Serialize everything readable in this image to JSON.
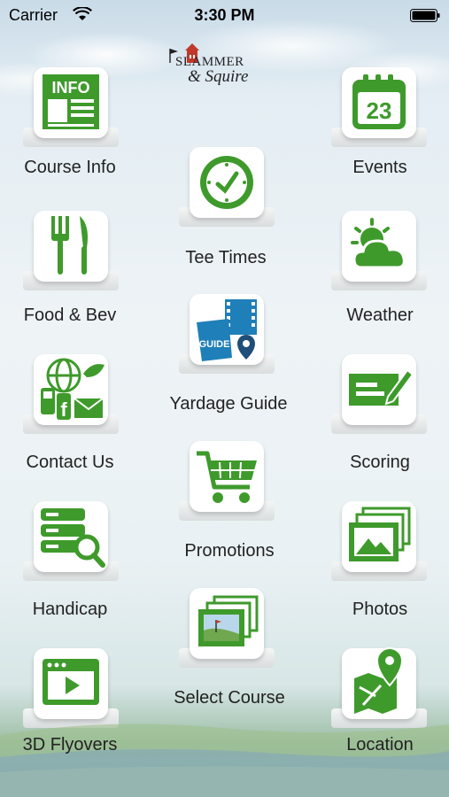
{
  "status_bar": {
    "carrier": "Carrier",
    "time": "3:30 PM"
  },
  "logo": {
    "line1": "SLAMMER",
    "line2": "& Squire"
  },
  "colors": {
    "icon_green": "#3f9a2c",
    "icon_blue": "#1f7fb8",
    "text": "#222222"
  },
  "menu": [
    {
      "label": "Course Info",
      "icon": "info-newspaper-icon"
    },
    {
      "label": "Tee Times",
      "icon": "clock-icon"
    },
    {
      "label": "Events",
      "icon": "calendar-icon",
      "date": "23",
      "info_text": "INFO"
    },
    {
      "label": "Food & Bev",
      "icon": "fork-knife-icon"
    },
    {
      "label": "Yardage Guide",
      "icon": "guide-map-icon",
      "badge": "GUIDE"
    },
    {
      "label": "Weather",
      "icon": "sun-cloud-icon"
    },
    {
      "label": "Contact Us",
      "icon": "contact-icon"
    },
    {
      "label": "Promotions",
      "icon": "cart-icon"
    },
    {
      "label": "Scoring",
      "icon": "scorecard-pencil-icon"
    },
    {
      "label": "Handicap",
      "icon": "handicap-search-icon"
    },
    {
      "label": "Select Course",
      "icon": "course-photos-icon"
    },
    {
      "label": "Photos",
      "icon": "photos-icon"
    },
    {
      "label": "3D Flyovers",
      "icon": "video-play-icon"
    },
    {
      "label": "Location",
      "icon": "map-pin-icon"
    }
  ]
}
